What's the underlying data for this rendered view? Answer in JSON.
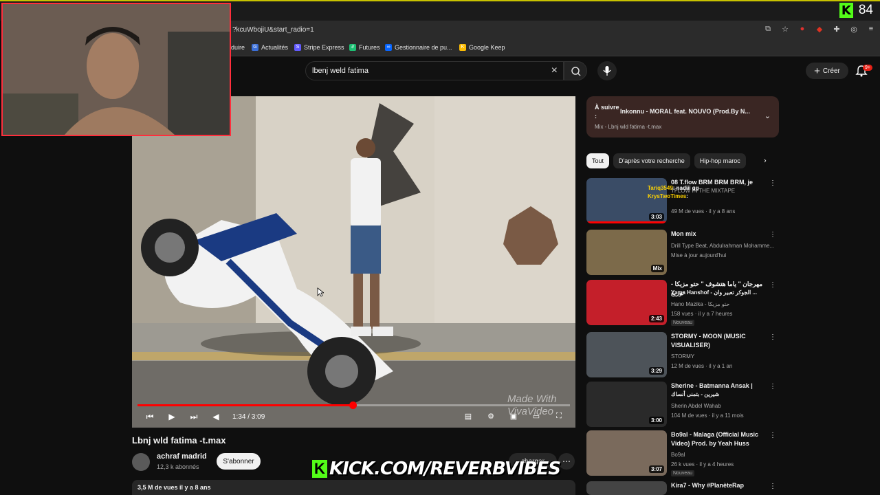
{
  "stream": {
    "viewer_count": "84",
    "kick_k": "K",
    "kick_banner_text": "KICK.COM/REVERBVIBES"
  },
  "browser": {
    "url_fragment": "?kcuWbojiU&start_radio=1",
    "bookmarks": [
      {
        "label": "duire",
        "icon": "translate-icon",
        "color": "#4a4a4a"
      },
      {
        "label": "Actualités",
        "icon": "news-icon",
        "color": "#3b6fd8"
      },
      {
        "label": "Stripe Express",
        "icon": "stripe-icon",
        "color": "#635bff"
      },
      {
        "label": "Futures",
        "icon": "futures-icon",
        "color": "#1dbf73"
      },
      {
        "label": "Gestionnaire de pu...",
        "icon": "meta-icon",
        "color": "#0866ff"
      },
      {
        "label": "Google Keep",
        "icon": "keep-icon",
        "color": "#fbbc04"
      }
    ]
  },
  "header": {
    "search_value": "lbenj weld fatima",
    "create_label": "Créer",
    "notif_badge": "9+"
  },
  "player": {
    "time": "1:34 / 3:09",
    "progress": 0.497,
    "watermark_line1": "Made With",
    "watermark_line2": "VivaVideo"
  },
  "video": {
    "title": "Lbnj wld fatima -t.max",
    "channel": "achraf madrid",
    "subscribers": "12,3 k abonnés",
    "subscribe_label": "S'abonner",
    "download_label": "charger",
    "meta": "3,5 M de vues  il y a 8 ans"
  },
  "upnext": {
    "label": "À suivre :",
    "title": "Inkonnu - MORAL feat. NOUVO (Prod.By N...",
    "sub": "Mix - Lbnj wld fatima -t.max"
  },
  "chips": [
    "Tout",
    "D'après votre recherche",
    "Hip-hop maroc"
  ],
  "chat": {
    "user1": "Tariq3549",
    "msg1": ": nadiii gg",
    "user2": "KrysTwoTimes",
    "msg2": ":"
  },
  "recs": [
    {
      "title": "08 T.flow BRM BRM BRM, je",
      "title2": "TFLOW IN THE MIXTAPE",
      "channel": "",
      "meta": "49 M de vues · il y a 8 ans",
      "duration": "3:03",
      "badge": "",
      "thumb_color": "#3a4c66"
    },
    {
      "title": "Mon mix",
      "title2": "",
      "channel": "Drill Type Beat, Abdulrahman Mohamme...",
      "meta": "Mise à jour aujourd'hui",
      "duration": "Mix",
      "badge": "",
      "thumb_color": "#7c6a4a"
    },
    {
      "title": "مهرجان \" ياما هتشوف \" حتو مزيكا - توزيع",
      "title2": "Yama Hanshof - الجوكر تعبير وان ...",
      "channel": "Hano Mazika - حتو مزيكا",
      "meta": "158 vues · il y a 7 heures",
      "duration": "2:43",
      "badge": "Nouveau",
      "thumb_color": "#c41f2a"
    },
    {
      "title": "STORMY - MOON (MUSIC VISUALISER)",
      "title2": "",
      "channel": "STORMY",
      "meta": "12 M de vues · il y a 1 an",
      "duration": "3:29",
      "badge": "",
      "thumb_color": "#4d5359"
    },
    {
      "title": "Sherine - Batmanna Ansak |",
      "title2": "شيرين - بتمنى أنساك",
      "channel": "Sherin Abdel Wahab",
      "meta": "104 M de vues · il y a 11 mois",
      "duration": "3:00",
      "badge": "",
      "thumb_color": "#2a2a2a"
    },
    {
      "title": "Bo9al - Malaga (Official Music Video) Prod. by Yeah Huss",
      "title2": "",
      "channel": "Bo9al",
      "meta": "26 k vues · il y a 4 heures",
      "duration": "3:07",
      "badge": "Nouveau",
      "thumb_color": "#7a6a5c"
    },
    {
      "title": "Kira7 - Why #PlanèteRap",
      "title2": "",
      "channel": "",
      "meta": "",
      "duration": "",
      "badge": "",
      "thumb_color": "#444"
    }
  ]
}
